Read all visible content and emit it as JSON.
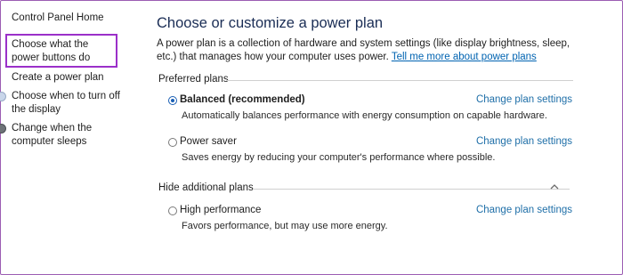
{
  "sidebar": {
    "home_label": "Control Panel Home",
    "items": [
      {
        "label": "Choose what the power buttons do"
      },
      {
        "label": "Create a power plan"
      },
      {
        "label": "Choose when to turn off the display"
      },
      {
        "label": "Change when the computer sleeps"
      }
    ]
  },
  "main": {
    "title": "Choose or customize a power plan",
    "description": "A power plan is a collection of hardware and system settings (like display brightness, sleep, etc.) that manages how your computer uses power.",
    "description_link": "Tell me more about power plans",
    "preferred_heading": "Preferred plans",
    "hidden_heading": "Hide additional plans",
    "plans": [
      {
        "name": "Balanced (recommended)",
        "description": "Automatically balances performance with energy consumption on capable hardware.",
        "selected": true,
        "link": "Change plan settings"
      },
      {
        "name": "Power saver",
        "description": "Saves energy by reducing your computer's performance where possible.",
        "selected": false,
        "link": "Change plan settings"
      },
      {
        "name": "High performance",
        "description": "Favors performance, but may use more energy.",
        "selected": false,
        "link": "Change plan settings"
      }
    ]
  },
  "colors": {
    "highlight_border": "#9b30c9",
    "link": "#0063b1",
    "title": "#1a2d55"
  },
  "icons": {
    "collapse": "chevron-up-icon",
    "radio_selected": "radio-selected-icon"
  }
}
